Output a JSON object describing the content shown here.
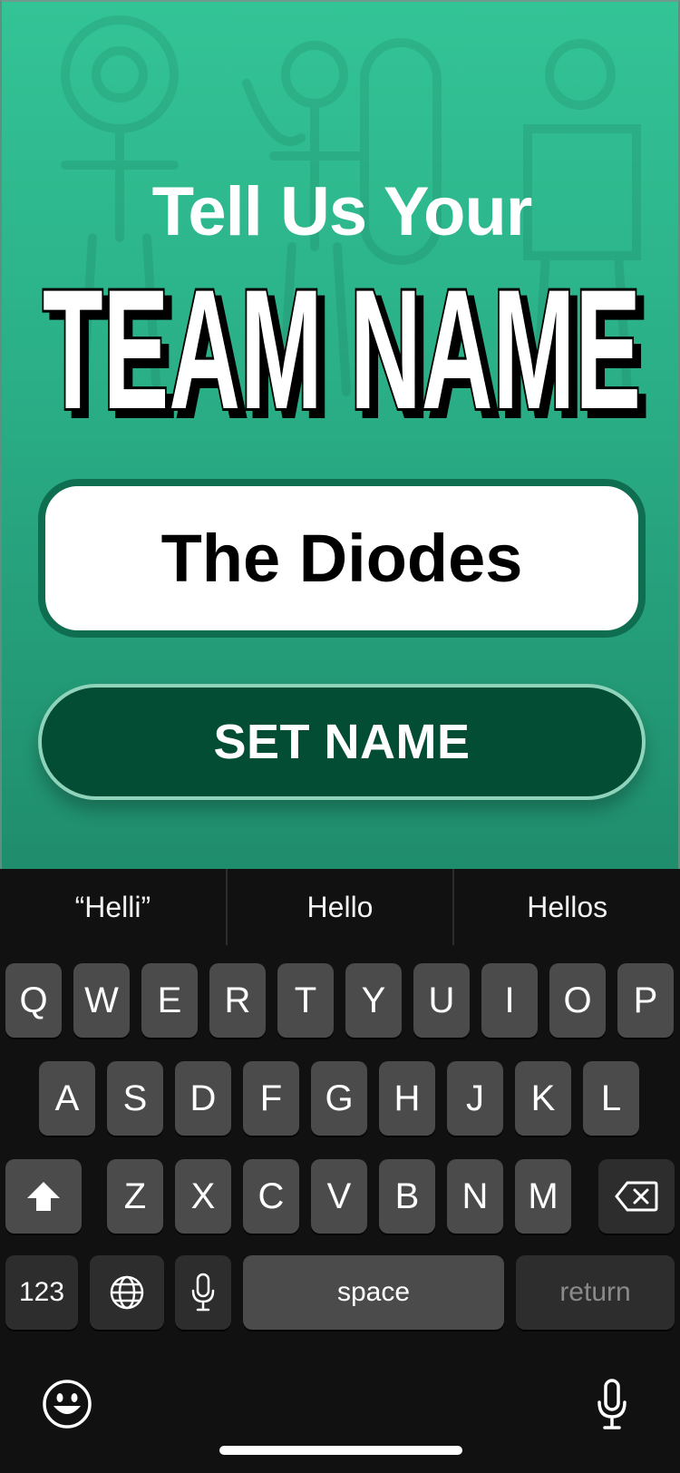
{
  "screen": {
    "headline_small": "Tell Us Your",
    "headline_big": "TEAM NAME",
    "team_name_value": "The Diodes",
    "set_name_label": "SET NAME"
  },
  "keyboard": {
    "suggestions": [
      "“Helli”",
      "Hello",
      "Hellos"
    ],
    "row1": [
      "Q",
      "W",
      "E",
      "R",
      "T",
      "Y",
      "U",
      "I",
      "O",
      "P"
    ],
    "row2": [
      "A",
      "S",
      "D",
      "F",
      "G",
      "H",
      "J",
      "K",
      "L"
    ],
    "row3": [
      "Z",
      "X",
      "C",
      "V",
      "B",
      "N",
      "M"
    ],
    "numbers_label": "123",
    "space_label": "space",
    "return_label": "return",
    "icons": {
      "shift": "shift-icon",
      "delete": "backspace-icon",
      "globe": "globe-icon",
      "mic": "microphone-icon",
      "emoji": "emoji-icon",
      "dictation": "dictation-icon"
    }
  },
  "colors": {
    "bg_top": "#33c496",
    "bg_bottom": "#1f8d6c",
    "button_bg": "#024d33",
    "input_border": "#0f6e4f",
    "keyboard_bg": "#111111",
    "key_bg": "#4b4b4b"
  }
}
